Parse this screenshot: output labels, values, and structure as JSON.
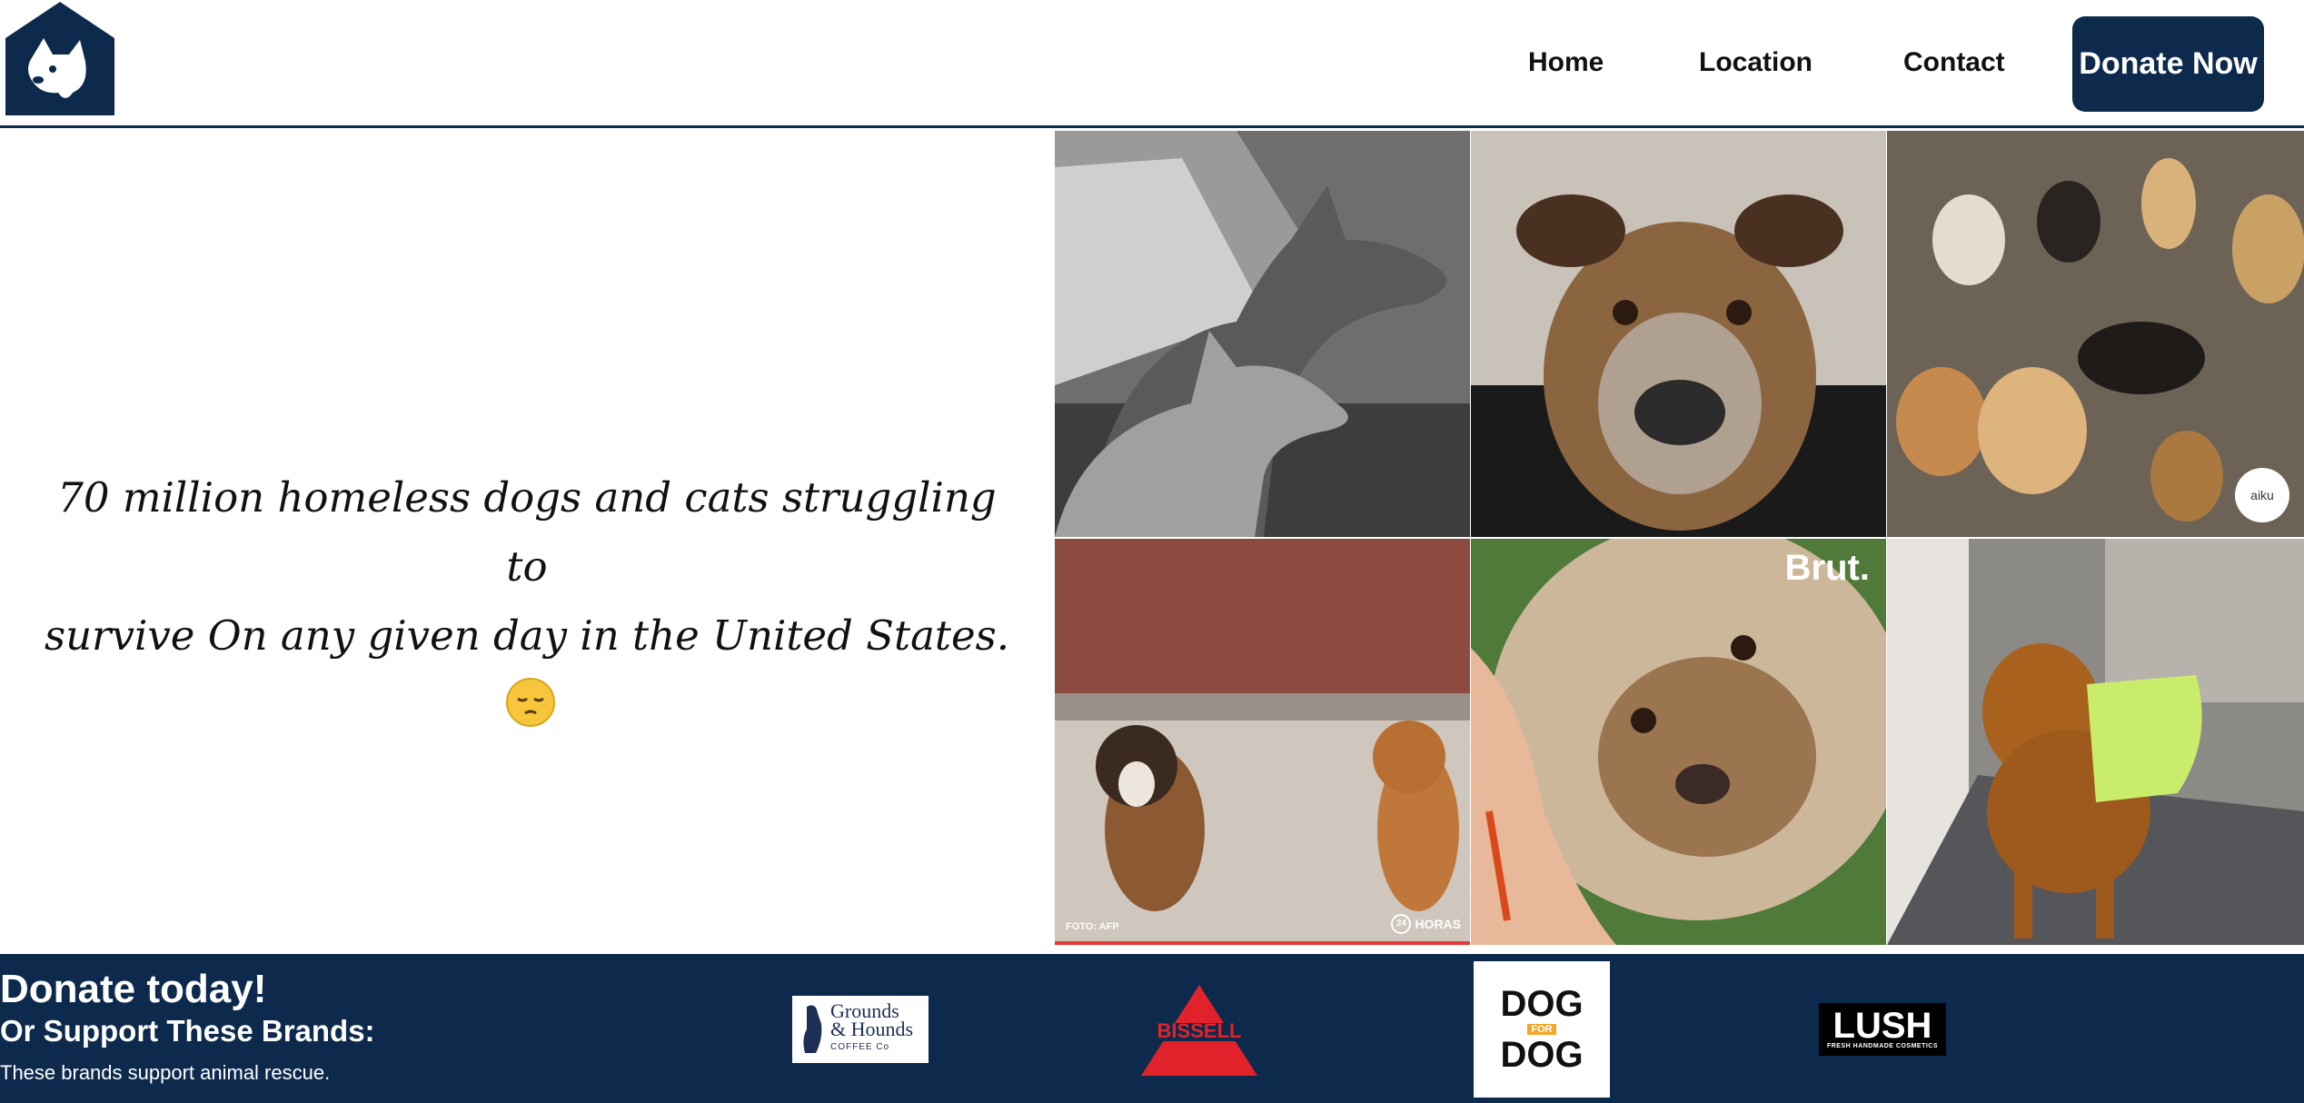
{
  "header": {
    "logo_name": "dog-house-logo",
    "nav": {
      "home": "Home",
      "location": "Location",
      "contact": "Contact"
    },
    "donate_button": "Donate Now"
  },
  "hero": {
    "line1": "70 million homeless dogs and cats struggling to",
    "line2": "survive On any given day in the United States.",
    "emoji": "pensive-face"
  },
  "gallery": {
    "watermarks": {
      "brut": "Brut.",
      "foto": "FOTO: AFP",
      "horas_num": "24",
      "horas": "HORAS",
      "aiku": "aiku"
    }
  },
  "footer": {
    "title": "Donate today!",
    "subtitle": "Or Support These Brands:",
    "note": "These brands support animal rescue.",
    "brands": {
      "grounds_line1": "Grounds",
      "grounds_line2": "& Hounds",
      "grounds_line3": "COFFEE Co",
      "bissell": "BISSELL",
      "dog_top": "DOG",
      "dog_for": "FOR",
      "dog_bottom": "DOG",
      "lush": "LUSH",
      "lush_tag": "FRESH HANDMADE COSMETICS"
    }
  },
  "colors": {
    "navy": "#0d2a4d",
    "accent_red": "#e53935"
  }
}
